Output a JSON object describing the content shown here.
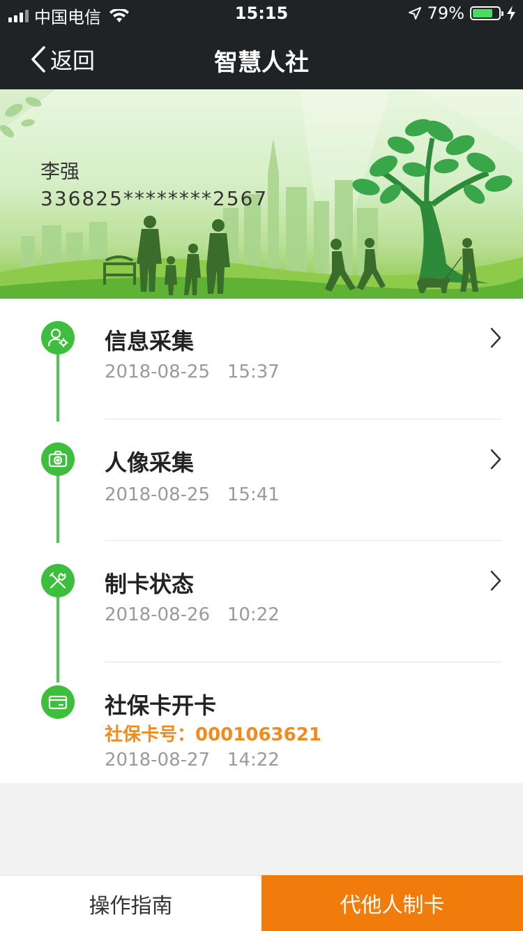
{
  "status_bar": {
    "carrier": "中国电信",
    "time": "15:15",
    "battery_percent": "79%",
    "battery_level": 0.79
  },
  "nav": {
    "back_label": "返回",
    "title": "智慧人社"
  },
  "card": {
    "name": "李强",
    "number": "336825********2567"
  },
  "steps": [
    {
      "title": "信息采集",
      "time": "2018-08-25   15:37",
      "icon": "user-gear-icon"
    },
    {
      "title": "人像采集",
      "time": "2018-08-25   15:41",
      "icon": "camera-icon"
    },
    {
      "title": "制卡状态",
      "time": "2018-08-26   10:22",
      "icon": "tools-icon"
    },
    {
      "title": "社保卡开卡",
      "card_no": "社保卡号：0001063621",
      "time": "2018-08-27   14:22",
      "icon": "card-icon"
    }
  ],
  "bottom": {
    "guide_label": "操作指南",
    "make_card_label": "代他人制卡"
  },
  "colors": {
    "header_bg": "#1f2326",
    "accent_green": "#3dbf3d",
    "accent_orange": "#f27c0a",
    "card_no_orange": "#f08c1e"
  }
}
